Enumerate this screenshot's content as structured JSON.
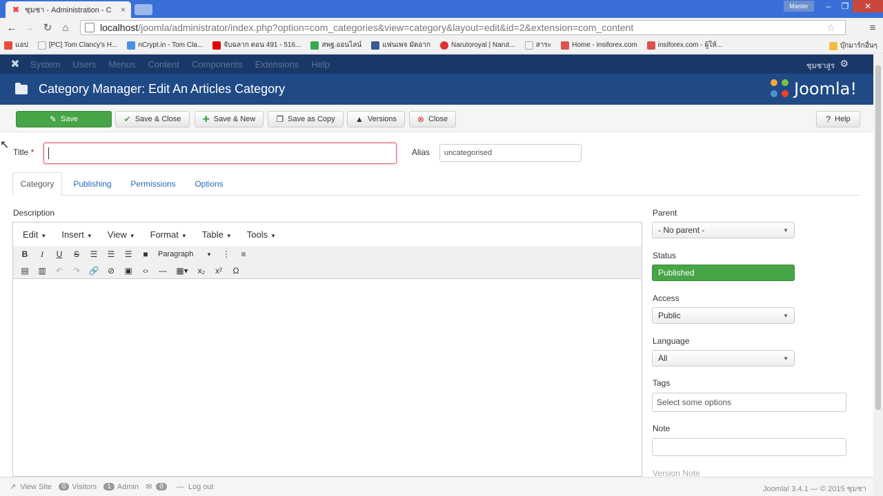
{
  "browser": {
    "tab_title": "ชุมชา - Administration - C",
    "tab_close": "×",
    "user_badge": "Master",
    "url_host": "localhost",
    "url_path": "/joomla/administrator/index.php?option=com_categories&view=category&layout=edit&id=2&extension=com_content",
    "bookmarks": [
      {
        "label": "แอป",
        "color": "#e74c3c"
      },
      {
        "label": "[PC] Tom Clancy's H...",
        "color": "#cccccc"
      },
      {
        "label": "nCrypt.in - Tom Cla...",
        "color": "#4a90e2"
      },
      {
        "label": "จับฉลาก ตอน 491 - 516...",
        "color": "#e00000"
      },
      {
        "label": "สพฐ.ออนไลน์",
        "color": "#34a853"
      },
      {
        "label": "แฟนเพจ มัดอาก",
        "color": "#3b5998"
      },
      {
        "label": "Narutoroyal | Narut...",
        "color": "#dd3333"
      },
      {
        "label": "สาระ",
        "color": "#cccccc"
      },
      {
        "label": "Home - insiforex.com",
        "color": "#d9534f"
      },
      {
        "label": "insiforex.com - ผู้ให้...",
        "color": "#d9534f"
      }
    ],
    "bookmarks_more": "บุ๊กมาร์กอื่นๆ"
  },
  "jnav": {
    "items": [
      "System",
      "Users",
      "Menus",
      "Content",
      "Components",
      "Extensions",
      "Help"
    ],
    "user": "ชุมชาสูร"
  },
  "header": {
    "title": "Category Manager: Edit An Articles Category",
    "brand": "Joomla!"
  },
  "actions": {
    "save": "Save",
    "save_close": "Save & Close",
    "save_new": "Save & New",
    "save_copy": "Save as Copy",
    "versions": "Versions",
    "close": "Close",
    "help": "Help"
  },
  "form": {
    "title_label": "Title",
    "required_mark": " *",
    "title_value": "",
    "alias_label": "Alias",
    "alias_value": "uncategorised",
    "tabs": [
      "Category",
      "Publishing",
      "Permissions",
      "Options"
    ],
    "description_label": "Description"
  },
  "editor": {
    "menus": [
      "Edit",
      "Insert",
      "View",
      "Format",
      "Table",
      "Tools"
    ],
    "format_select": "Paragraph"
  },
  "sidebar": {
    "parent_label": "Parent",
    "parent_value": "- No parent -",
    "status_label": "Status",
    "status_value": "Published",
    "access_label": "Access",
    "access_value": "Public",
    "language_label": "Language",
    "language_value": "All",
    "tags_label": "Tags",
    "tags_placeholder": "Select some options",
    "note_label": "Note",
    "version_note_label": "Version Note"
  },
  "statusbar": {
    "view_site": "View Site",
    "visitors_count": "0",
    "visitors": "Visitors",
    "admin_count": "1",
    "admin": "Admin",
    "messages_count": "0",
    "logout": "Log out",
    "copyright": "Joomla! 3.4.1 — © 2015 ชุมชา"
  },
  "colors": {
    "nav_bg": "#1a3867",
    "header_bg": "#1f4a85",
    "success": "#46a546",
    "link": "#2a69b8"
  }
}
